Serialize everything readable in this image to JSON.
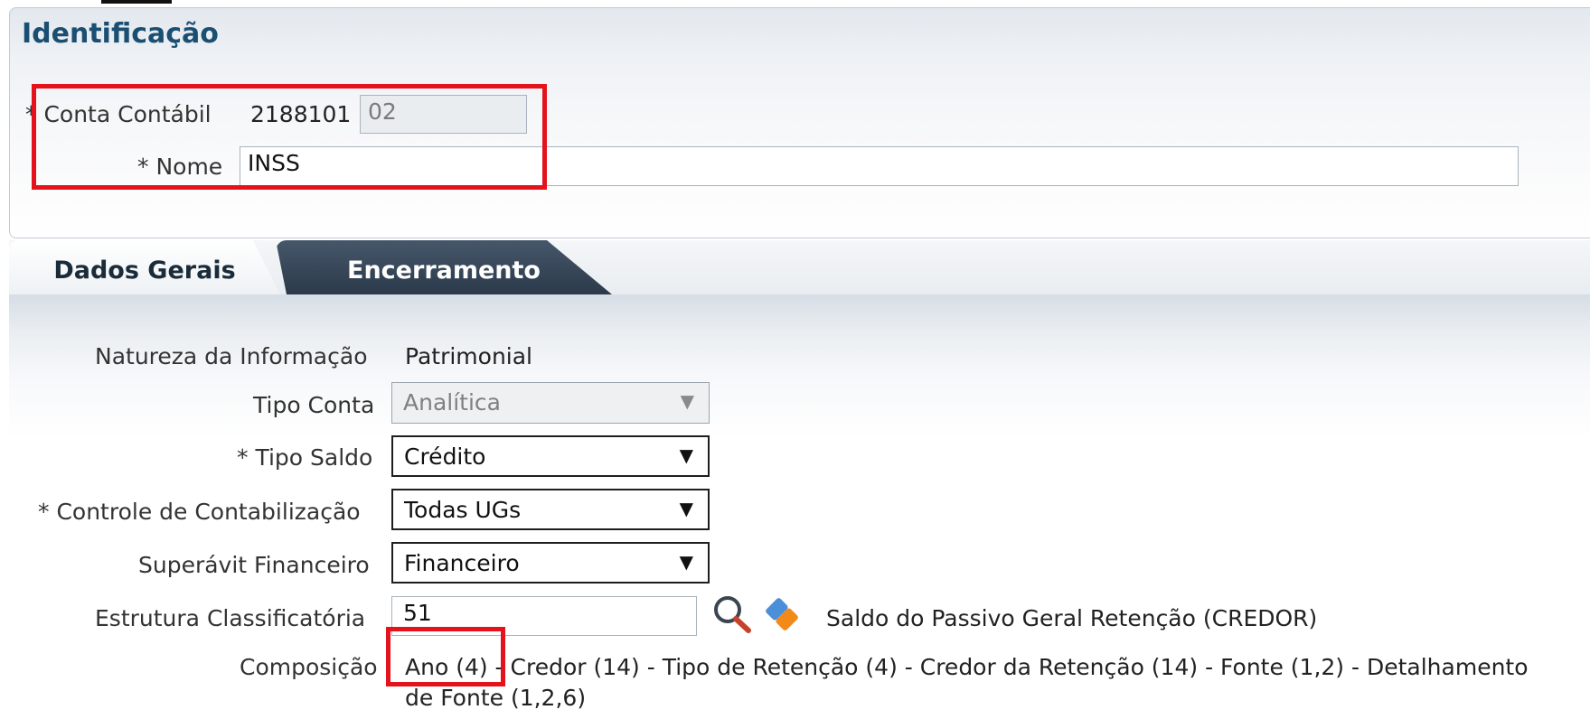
{
  "identificacao": {
    "title": "Identificação",
    "conta_contabil": {
      "label": "* Conta Contábil",
      "prefix": "2188101",
      "suffix": "02"
    },
    "nome": {
      "label": "* Nome",
      "value": "INSS"
    }
  },
  "tabs": [
    {
      "label": "Dados Gerais",
      "active": true
    },
    {
      "label": "Encerramento",
      "active": false
    }
  ],
  "dados_gerais": {
    "natureza": {
      "label": "Natureza da Informação",
      "value": "Patrimonial"
    },
    "tipo_conta": {
      "label": "Tipo Conta",
      "value": "Analítica"
    },
    "tipo_saldo": {
      "label": "* Tipo Saldo",
      "value": "Crédito"
    },
    "controle": {
      "label": "* Controle de Contabilização",
      "value": "Todas UGs"
    },
    "superavit": {
      "label": "Superávit Financeiro",
      "value": "Financeiro"
    },
    "estrutura": {
      "label": "Estrutura Classificatória",
      "value": "51",
      "description": "Saldo do Passivo Geral Retenção (CREDOR)"
    },
    "composicao": {
      "label": "Composição",
      "line1": "Ano (4) - Credor (14) - Tipo de Retenção (4) - Credor da Retenção (14) - Fonte (1,2) - Detalhamento",
      "line2": "de Fonte (1,2,6)"
    }
  },
  "icons": {
    "search": "search-icon",
    "eraser": "eraser-icon"
  },
  "colors": {
    "highlight": "#e3121b",
    "title": "#1b4f72",
    "active_tab_text": "#1b2b3a",
    "inactive_tab_bg": "#2b3a4a"
  }
}
